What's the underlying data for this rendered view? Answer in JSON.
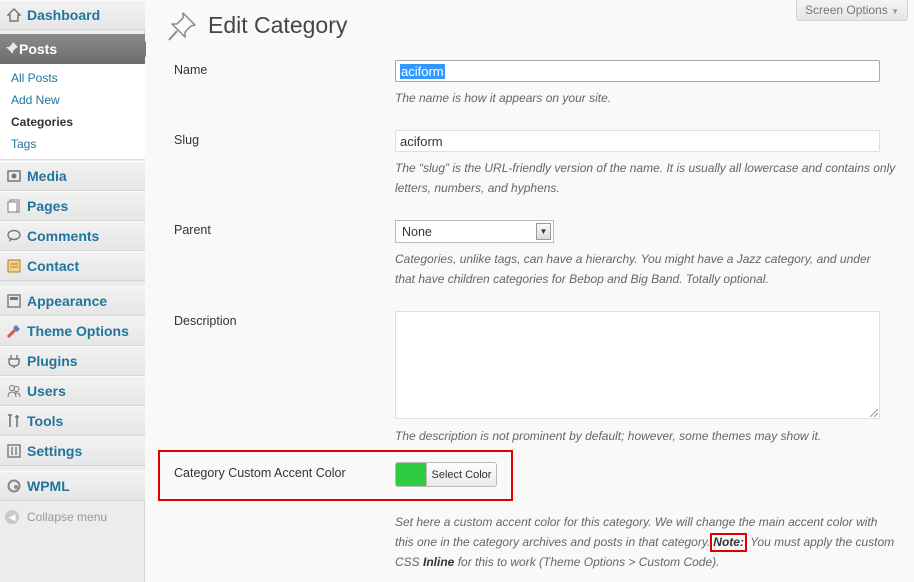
{
  "sidebar": {
    "dashboard": "Dashboard",
    "posts": "Posts",
    "posts_sub": [
      "All Posts",
      "Add New",
      "Categories",
      "Tags"
    ],
    "items": [
      "Media",
      "Pages",
      "Comments",
      "Contact",
      "Appearance",
      "Theme Options",
      "Plugins",
      "Users",
      "Tools",
      "Settings",
      "WPML"
    ],
    "collapse": "Collapse menu"
  },
  "header": {
    "screen_options": "Screen Options",
    "title": "Edit Category"
  },
  "form": {
    "name": {
      "label": "Name",
      "value": "aciform",
      "help": "The name is how it appears on your site."
    },
    "slug": {
      "label": "Slug",
      "value": "aciform",
      "help_1": "The “slug” is the URL-friendly version of the name. It is usually all lowercase and contains only",
      "help_2": "letters, numbers, and hyphens."
    },
    "parent": {
      "label": "Parent",
      "selected": "None",
      "help_1": "Categories, unlike tags, can have a hierarchy. You might have a Jazz category, and under",
      "help_2": "that have children categories for Bebop and Big Band. Totally optional."
    },
    "description": {
      "label": "Description",
      "value": "",
      "help": "The description is not prominent by default; however, some themes may show it."
    },
    "accent": {
      "label": "Category Custom Accent Color",
      "button": "Select Color",
      "color": "#2ecc40",
      "help_1": "Set here a custom accent color for this category. We will change the main accent color with",
      "help_2a": "this one in the category archives and posts in that category.",
      "note": "Note:",
      "help_2b": " You must apply the custom",
      "help_3a": "CSS ",
      "inline": "Inline",
      "help_3b": " for this to work (Theme Options > Custom Code)."
    }
  },
  "colors": {
    "link": "#21759b",
    "highlight_box": "#e00000"
  }
}
